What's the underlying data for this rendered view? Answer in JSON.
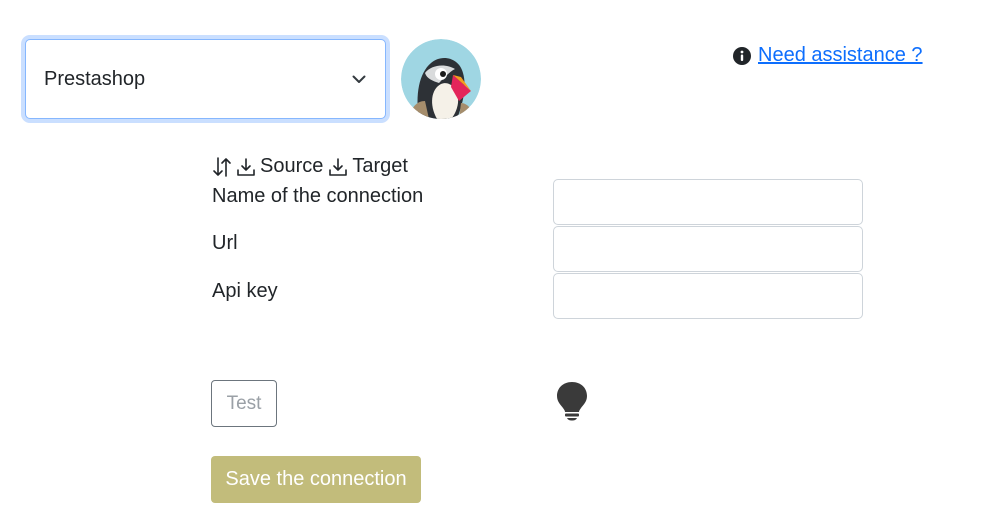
{
  "connector_select": {
    "value": "Prestashop"
  },
  "logo": {
    "name": "prestashop-puffin-logo"
  },
  "help": {
    "label": "Need assistance ?",
    "icon": "info-circle-icon"
  },
  "direction": {
    "icons": [
      "swap-vertical-icon",
      "download-icon"
    ],
    "source_label": "Source",
    "target_label": "Target"
  },
  "fields": {
    "name_label": "Name of the connection",
    "name_value": "",
    "url_label": "Url",
    "url_value": "",
    "apikey_label": "Api key",
    "apikey_value": ""
  },
  "buttons": {
    "test": "Test",
    "save": "Save the connection"
  },
  "colors": {
    "link": "#0d6efd",
    "focus_border": "#86b7fe",
    "save_button": "#c2bc7b",
    "bulb": "#3a3a3a"
  }
}
